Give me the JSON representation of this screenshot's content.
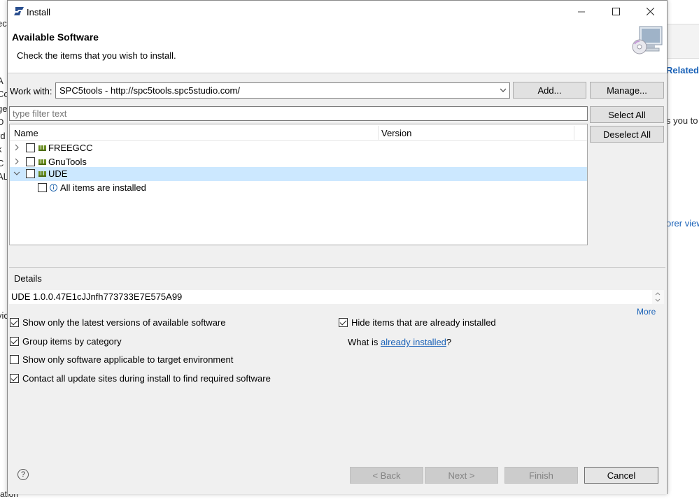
{
  "background": {
    "left_fragments": [
      "ec",
      "A",
      "Co",
      "ge",
      "D",
      "rd",
      "k",
      "C",
      "AL",
      "vic"
    ],
    "right_related": "Related",
    "right_text": "s you to",
    "right_link": "orer view",
    "bottom_fragment": "ation"
  },
  "window": {
    "title": "Install",
    "heading": "Available Software",
    "description": "Check the items that you wish to install."
  },
  "work_with": {
    "label": "Work with:",
    "value": "SPC5tools - http://spc5tools.spc5studio.com/",
    "add_label": "Add...",
    "manage_label": "Manage..."
  },
  "filter": {
    "placeholder": "type filter text"
  },
  "selection_buttons": {
    "select_all": "Select All",
    "deselect_all": "Deselect All"
  },
  "tree": {
    "columns": [
      "Name",
      "Version"
    ],
    "rows": [
      {
        "label": "FREEGCC",
        "expanded": false,
        "checked": false
      },
      {
        "label": "GnuTools",
        "expanded": false,
        "checked": false
      },
      {
        "label": "UDE",
        "expanded": true,
        "checked": false,
        "selected": true
      },
      {
        "label": "All items are installed",
        "child": true,
        "checked": false
      }
    ]
  },
  "details": {
    "label": "Details",
    "value": "UDE 1.0.0.47E1cJJnfh773733E7E575A99",
    "more": "More"
  },
  "options": {
    "show_latest": {
      "label": "Show only the latest versions of available software",
      "checked": true
    },
    "group_by_category": {
      "label": "Group items by category",
      "checked": true
    },
    "show_applicable": {
      "label": "Show only software applicable to target environment",
      "checked": false
    },
    "contact_sites": {
      "label": "Contact all update sites during install to find required software",
      "checked": true
    },
    "hide_installed": {
      "label": "Hide items that are already installed",
      "checked": true
    },
    "what_is_prefix": "What is",
    "what_is_link": "already installed",
    "what_is_suffix": "?"
  },
  "footer": {
    "help": "?",
    "back": "< Back",
    "next": "Next >",
    "finish": "Finish",
    "cancel": "Cancel"
  },
  "colors": {
    "selection": "#cce8ff",
    "link": "#1a62b8",
    "dialog_bg": "#f0f0f0"
  }
}
